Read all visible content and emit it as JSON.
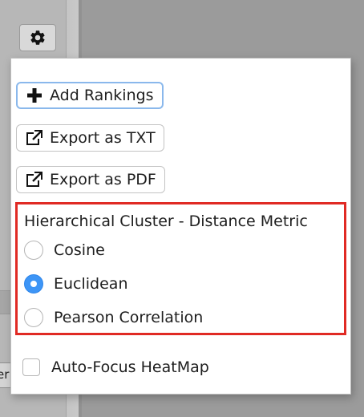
{
  "background": {
    "partial_text": "er"
  },
  "toolbar": {
    "settings_icon": "gear-icon"
  },
  "menu": {
    "add_rankings": {
      "label": "Add Rankings",
      "icon": "plus-icon"
    },
    "export_txt": {
      "label": "Export as TXT",
      "icon": "external-link-icon"
    },
    "export_pdf": {
      "label": "Export as PDF",
      "icon": "external-link-icon"
    },
    "distance_metric": {
      "title": "Hierarchical Cluster - Distance Metric",
      "options": [
        {
          "label": "Cosine",
          "selected": false
        },
        {
          "label": "Euclidean",
          "selected": true
        },
        {
          "label": "Pearson Correlation",
          "selected": false
        }
      ]
    },
    "auto_focus": {
      "label": "Auto-Focus HeatMap",
      "checked": false
    }
  },
  "colors": {
    "highlight_border": "#e02a24",
    "radio_selected": "#3d95f6",
    "focus_ring": "#8ab8ec"
  }
}
